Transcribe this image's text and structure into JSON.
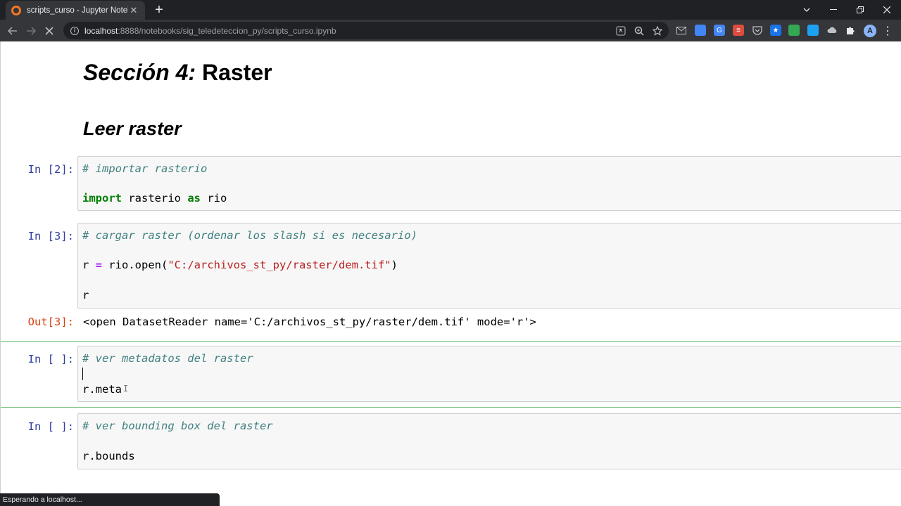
{
  "browser": {
    "tab_title": "scripts_curso - Jupyter Notebook",
    "tab_close": "✕",
    "new_tab": "+",
    "url_host": "localhost",
    "url_rest": ":8888/notebooks/sig_teledeteccion_py/scripts_curso.ipynb",
    "status_text": "Esperando a localhost..."
  },
  "notebook": {
    "heading1_italic": "Sección 4:",
    "heading1_rest": " Raster",
    "heading2": "Leer raster",
    "cells": [
      {
        "prompt": "In [2]:",
        "comment": "# importar rasterio",
        "import_kw": "import",
        "import_mod": " rasterio ",
        "as_kw": "as",
        "alias": " rio"
      },
      {
        "prompt": "In [3]:",
        "comment": "# cargar raster (ordenar los slash si es necesario)",
        "var": "r ",
        "op": "=",
        "call": " rio.open(",
        "string": "\"C:/archivos_st_py/raster/dem.tif\"",
        "close": ")",
        "last": "r",
        "out_prompt": "Out[3]:",
        "output": "<open DatasetReader name='C:/archivos_st_py/raster/dem.tif' mode='r'>"
      },
      {
        "prompt": "In [ ]:",
        "comment": "# ver metadatos del raster",
        "code": "r.meta"
      },
      {
        "prompt": "In [ ]:",
        "comment": "# ver bounding box del raster",
        "code": "r.bounds"
      }
    ]
  }
}
